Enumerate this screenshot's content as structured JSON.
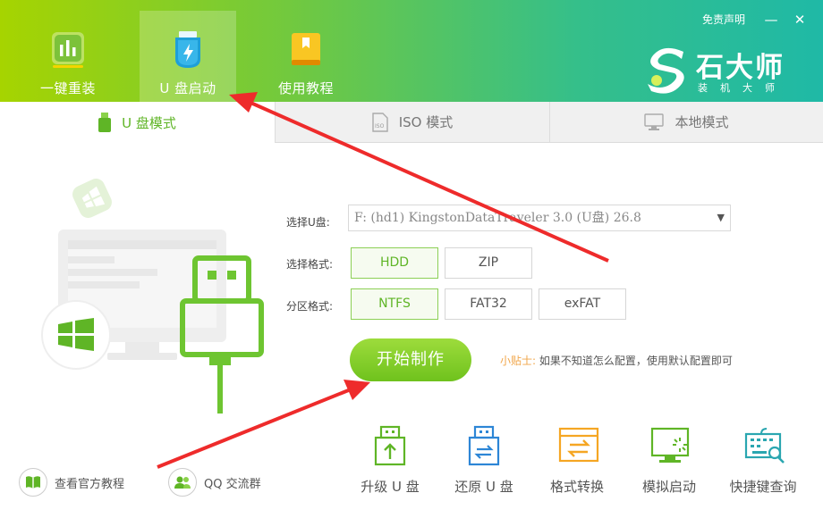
{
  "header": {
    "nav": [
      {
        "label": "一键重装",
        "icon": "bar-chart-icon"
      },
      {
        "label": "U 盘启动",
        "icon": "usb-drive-icon",
        "active": true
      },
      {
        "label": "使用教程",
        "icon": "book-icon"
      }
    ],
    "disclaimer": "免责声明",
    "minimize": "—",
    "close": "✕",
    "brand_title": "石大师",
    "brand_sub": "装机大师"
  },
  "mode_tabs": [
    {
      "label": "U 盘模式",
      "active": true
    },
    {
      "label": "ISO 模式"
    },
    {
      "label": "本地模式"
    }
  ],
  "form": {
    "usb_label": "选择U盘:",
    "usb_value": "F: (hd1) KingstonDataTraveler 3.0 (U盘) 26.8",
    "format_label": "选择格式:",
    "format_options": [
      "HDD",
      "ZIP"
    ],
    "format_selected": "HDD",
    "partition_label": "分区格式:",
    "partition_options": [
      "NTFS",
      "FAT32",
      "exFAT"
    ],
    "partition_selected": "NTFS",
    "start_button": "开始制作",
    "tip_key": "小贴士:",
    "tip_text": "如果不知道怎么配置，使用默认配置即可"
  },
  "tools": [
    {
      "label": "升级 U 盘",
      "icon": "usb-upgrade-icon"
    },
    {
      "label": "还原 U 盘",
      "icon": "usb-restore-icon"
    },
    {
      "label": "格式转换",
      "icon": "format-convert-icon"
    },
    {
      "label": "模拟启动",
      "icon": "simulate-boot-icon"
    },
    {
      "label": "快捷键查询",
      "icon": "keyboard-search-icon"
    }
  ],
  "bottom_links": [
    {
      "label": "查看官方教程",
      "icon": "book-open-icon"
    },
    {
      "label": "QQ 交流群",
      "icon": "group-icon"
    }
  ],
  "colors": {
    "accent_green": "#6fc21d",
    "tool_icon_green": "#5fb526",
    "tool_icon_blue": "#2d86d6",
    "tool_icon_orange": "#f5a623",
    "tool_icon_teal": "#2aa6b0",
    "tip_orange": "#f1a64a",
    "arrow_red": "#ee2b2b"
  }
}
